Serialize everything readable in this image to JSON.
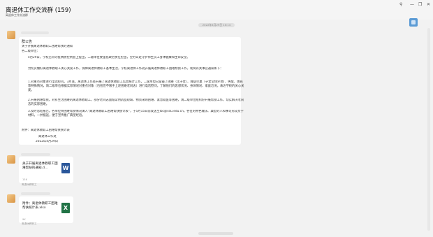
{
  "window": {
    "title": "离退休工作交流群 (159)",
    "subtitle": "离退休工作交流群",
    "controls": [
      "pin",
      "minimize",
      "restore",
      "close"
    ]
  },
  "header_icon": "app-icon",
  "timestamp": "2022年4月29日 10:14",
  "messages": [
    {
      "type": "announcement",
      "label": "群公告",
      "lines": [
        "关于开展离退休教职工困难帮扶的通知",
        "各二级单位：",
        "4月29日，学校召开的疫情防控例会上提出，二级单位要强化政治责任担当，全力以赴守护师生员工身体健康和生命安全。",
        "为切实做好离退休教职工关心关爱工作，保障离退休教职工基本生活，学校离退休工作处开展离退休教职工困难帮扶工作，现将有关事宜通知如下：",
        "1.对重点对象进行电话慰问。3月底，离退休工作处开展了离退休教职工信息统计工作，二级单位已掌握了困难（无子女）、独居空巢（子女常住外地）、失能、患病等特殊情况，请二级单位根据实际情况对重点对象（包括但不限于上述困难老同志）进行电话慰问，了解他们的思想状况、身体情况、家庭近况，表达学校的关心关爱。",
        "2.开展困难帮扶。对有生活困难的离退休教职工，部分老同志面临常用药品短缺、物资采购困难、紧急就医等困难，请二级单位组织好开展帮扶工作，切实解决老同志的实际困难。",
        "3.及时总结报告。各单位将困难帮扶情况填入“离退休教职工困难帮扶统计表”，于5月15日前发送至lbc@sdu.edu.cn。各位的特色做法、典型的人和事可形成文字材料，一并报送，便于宣传推广典型经验。",
        "附件：离退休教职工困难帮扶统计表"
      ],
      "signature": "离退休工作处",
      "date": "2022年4月29日"
    },
    {
      "type": "file",
      "name": "关于开展离退休教职工困难帮扶的通知.d...",
      "size": "15K",
      "source": "离退休教职工",
      "icon": "word-file-icon",
      "icon_letter": "W"
    },
    {
      "type": "file",
      "name": "附件：离退休教职工困难帮扶统计表.xlsx",
      "size": "9K",
      "source": "离退休教职工",
      "icon": "excel-file-icon",
      "icon_letter": "X"
    }
  ],
  "colors": {
    "window_bg": "#f2f2f2",
    "bubble_bg": "#ffffff",
    "word": "#2b579a",
    "excel": "#217346"
  }
}
